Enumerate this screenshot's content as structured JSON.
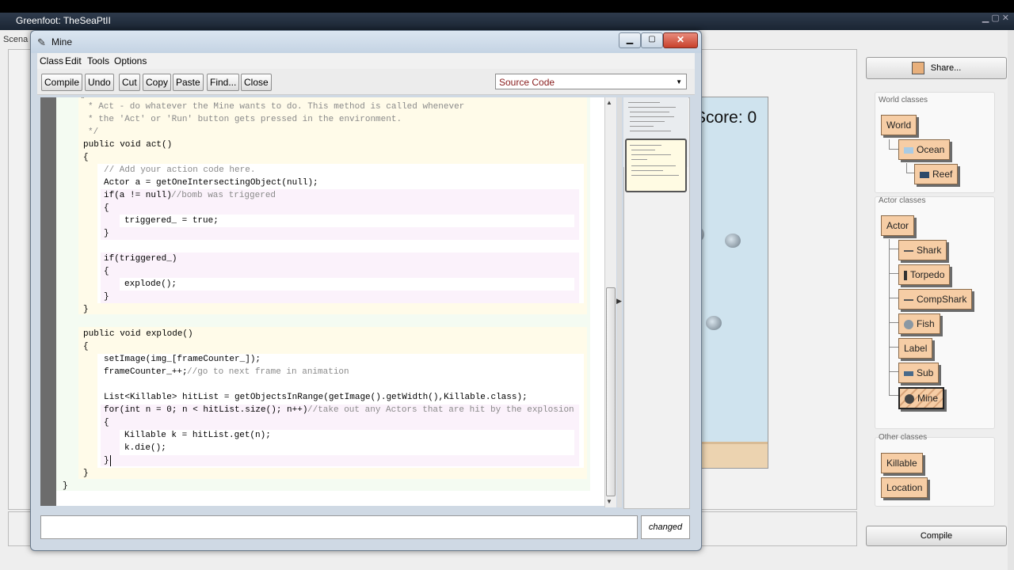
{
  "background_window": {
    "title": "Greenfoot: TheSeaPtII",
    "menu_fragment": "Scena",
    "world": {
      "score_text": "Score: 0"
    },
    "share_label": "Share...",
    "compile_label": "Compile"
  },
  "class_browser": {
    "world_label": "World classes",
    "world_classes": [
      "World",
      "Ocean",
      "Reef"
    ],
    "actor_label": "Actor classes",
    "actor_root": "Actor",
    "actor_classes": [
      "Shark",
      "Torpedo",
      "CompShark",
      "Fish",
      "Label",
      "Sub",
      "Mine"
    ],
    "selected_class": "Mine",
    "other_label": "Other classes",
    "other_classes": [
      "Killable",
      "Location"
    ]
  },
  "editor": {
    "title": "Mine",
    "menu": [
      "Class",
      "Edit",
      "Tools",
      "Options"
    ],
    "toolbar": [
      "Compile",
      "Undo",
      "Cut",
      "Copy",
      "Paste",
      "Find...",
      "Close"
    ],
    "view_select": "Source Code",
    "code_lines": [
      "* Act - do whatever the Mine wants to do. This method is called whenever",
      "* the 'Act' or 'Run' button gets pressed in the environment.",
      "*/",
      "public void act()",
      "{",
      "// Add your action code here.",
      "Actor a = getOneIntersectingObject(null);",
      "if(a != null)",
      "//bomb was triggered",
      "{",
      "triggered_ = true;",
      "}",
      "if(triggered_)",
      "{",
      "explode();",
      "}",
      "}",
      "public void explode()",
      "{",
      "setImage(img_[frameCounter_]);",
      "frameCounter_++;",
      "//go to next frame in animation",
      "List<Killable> hitList = getObjectsInRange(getImage().getWidth(),Killable.class);",
      "for(int n = 0; n < hitList.size(); n++)",
      "//take out any Actors that are hit by the explosion",
      "{",
      "Killable k = hitList.get(n);",
      "k.die();",
      "}",
      "}",
      "}"
    ],
    "status_message": "",
    "changed_label": "changed"
  }
}
